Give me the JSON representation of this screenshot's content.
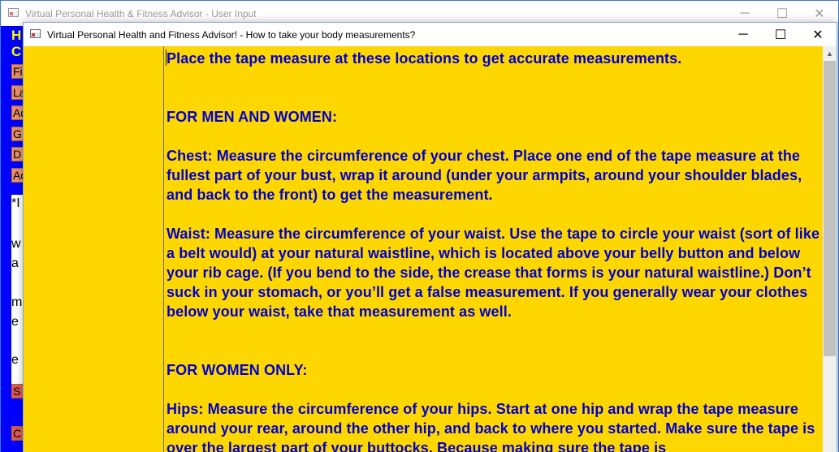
{
  "back_window": {
    "title": "Virtual Personal Health & Fitness Advisor - User Input",
    "peek": {
      "heading_1": "H",
      "heading_2": "C",
      "button_1": "Fi",
      "button_2": "La",
      "button_3": "Ad",
      "button_4": "G",
      "button_5": "D",
      "button_6": "Ad",
      "text_1": "*I",
      "text_2": "w",
      "text_3": "a",
      "text_4": "m",
      "text_5": "e",
      "text_6": "e",
      "button_7": "S",
      "button_8": "C"
    }
  },
  "front_window": {
    "title": "Virtual Personal Health and Fitness Advisor! - How to take your body measurements?",
    "content": {
      "intro": "Place the tape measure at these locations to get accurate measurements.",
      "section_men_women": "FOR MEN AND WOMEN:",
      "chest": "Chest: Measure the circumference of your chest. Place one end of the tape measure at the fullest part of your bust, wrap it around (under your armpits, around your shoulder blades, and back to the front) to get the measurement.",
      "waist": "Waist: Measure the circumference of your waist. Use the tape to circle your waist (sort of like a belt would) at your natural waistline, which is located above your belly button and below your rib cage. (If you bend to the side, the crease that forms is your natural waistline.) Don’t suck in your stomach, or you’ll get a false measurement. If you generally wear your clothes below your waist, take that measurement as well.",
      "section_women": "FOR WOMEN ONLY:",
      "hips": "Hips: Measure the circumference of your hips. Start at one hip and wrap the tape measure around your rear, around the other hip, and back to where you started. Make sure the tape is over the largest part of your buttocks. Because making sure the tape is"
    }
  },
  "window_controls": {
    "minimize": "─",
    "maximize": "☐",
    "close": "✕"
  },
  "colors": {
    "accent_yellow": "#ffd700",
    "text_blue": "#0000cc",
    "back_panel_blue": "#0000ff",
    "peek_button": "#e8916b",
    "peek_button_red": "#df5b57"
  }
}
